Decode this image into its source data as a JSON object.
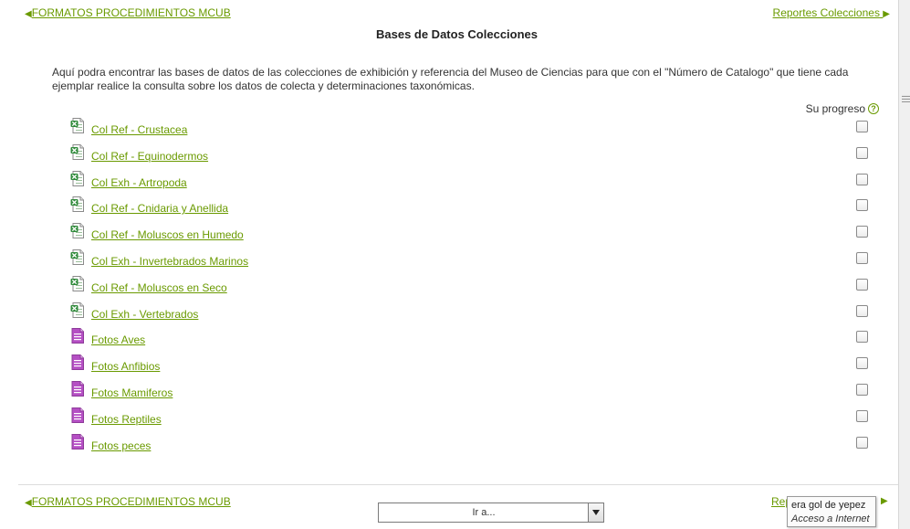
{
  "nav": {
    "prev_label": "FORMATOS PROCEDIMIENTOS MCUB",
    "next_label": "Reportes Colecciones",
    "next_bottom_partial": "Rep"
  },
  "page": {
    "title": "Bases de Datos Colecciones",
    "intro": "Aquí podra encontrar las bases de datos de las colecciones de exhibición y referencia del Museo de Ciencias para que con el \"Número de Catalogo\" que tiene cada ejemplar realice la consulta sobre los datos de colecta y determinaciones taxonómicas.",
    "progress_label": "Su progreso"
  },
  "activities": [
    {
      "label": "Col Ref - Crustacea",
      "icon": "spreadsheet-icon"
    },
    {
      "label": "Col Ref - Equinodermos",
      "icon": "spreadsheet-icon"
    },
    {
      "label": "Col Exh - Artropoda",
      "icon": "spreadsheet-icon"
    },
    {
      "label": "Col Ref - Cnidaria y Anellida",
      "icon": "spreadsheet-icon"
    },
    {
      "label": "Col Ref - Moluscos en Humedo",
      "icon": "spreadsheet-icon"
    },
    {
      "label": "Col Exh - Invertebrados Marinos",
      "icon": "spreadsheet-icon"
    },
    {
      "label": "Col Ref - Moluscos en Seco",
      "icon": "spreadsheet-icon"
    },
    {
      "label": "Col Exh - Vertebrados",
      "icon": "spreadsheet-icon"
    },
    {
      "label": "Fotos Aves",
      "icon": "document-icon"
    },
    {
      "label": "Fotos Anfibios",
      "icon": "document-icon"
    },
    {
      "label": "Fotos Mamiferos",
      "icon": "document-icon"
    },
    {
      "label": "Fotos Reptiles",
      "icon": "document-icon"
    },
    {
      "label": "Fotos peces",
      "icon": "document-icon"
    }
  ],
  "jump": {
    "selected": "Ir a..."
  },
  "tooltip": {
    "line1": "era gol de yepez",
    "line2": "Acceso a Internet"
  },
  "colors": {
    "link": "#6a9a00",
    "spreadsheet_icon": "#2f8a3a",
    "document_icon": "#b54fc4"
  }
}
